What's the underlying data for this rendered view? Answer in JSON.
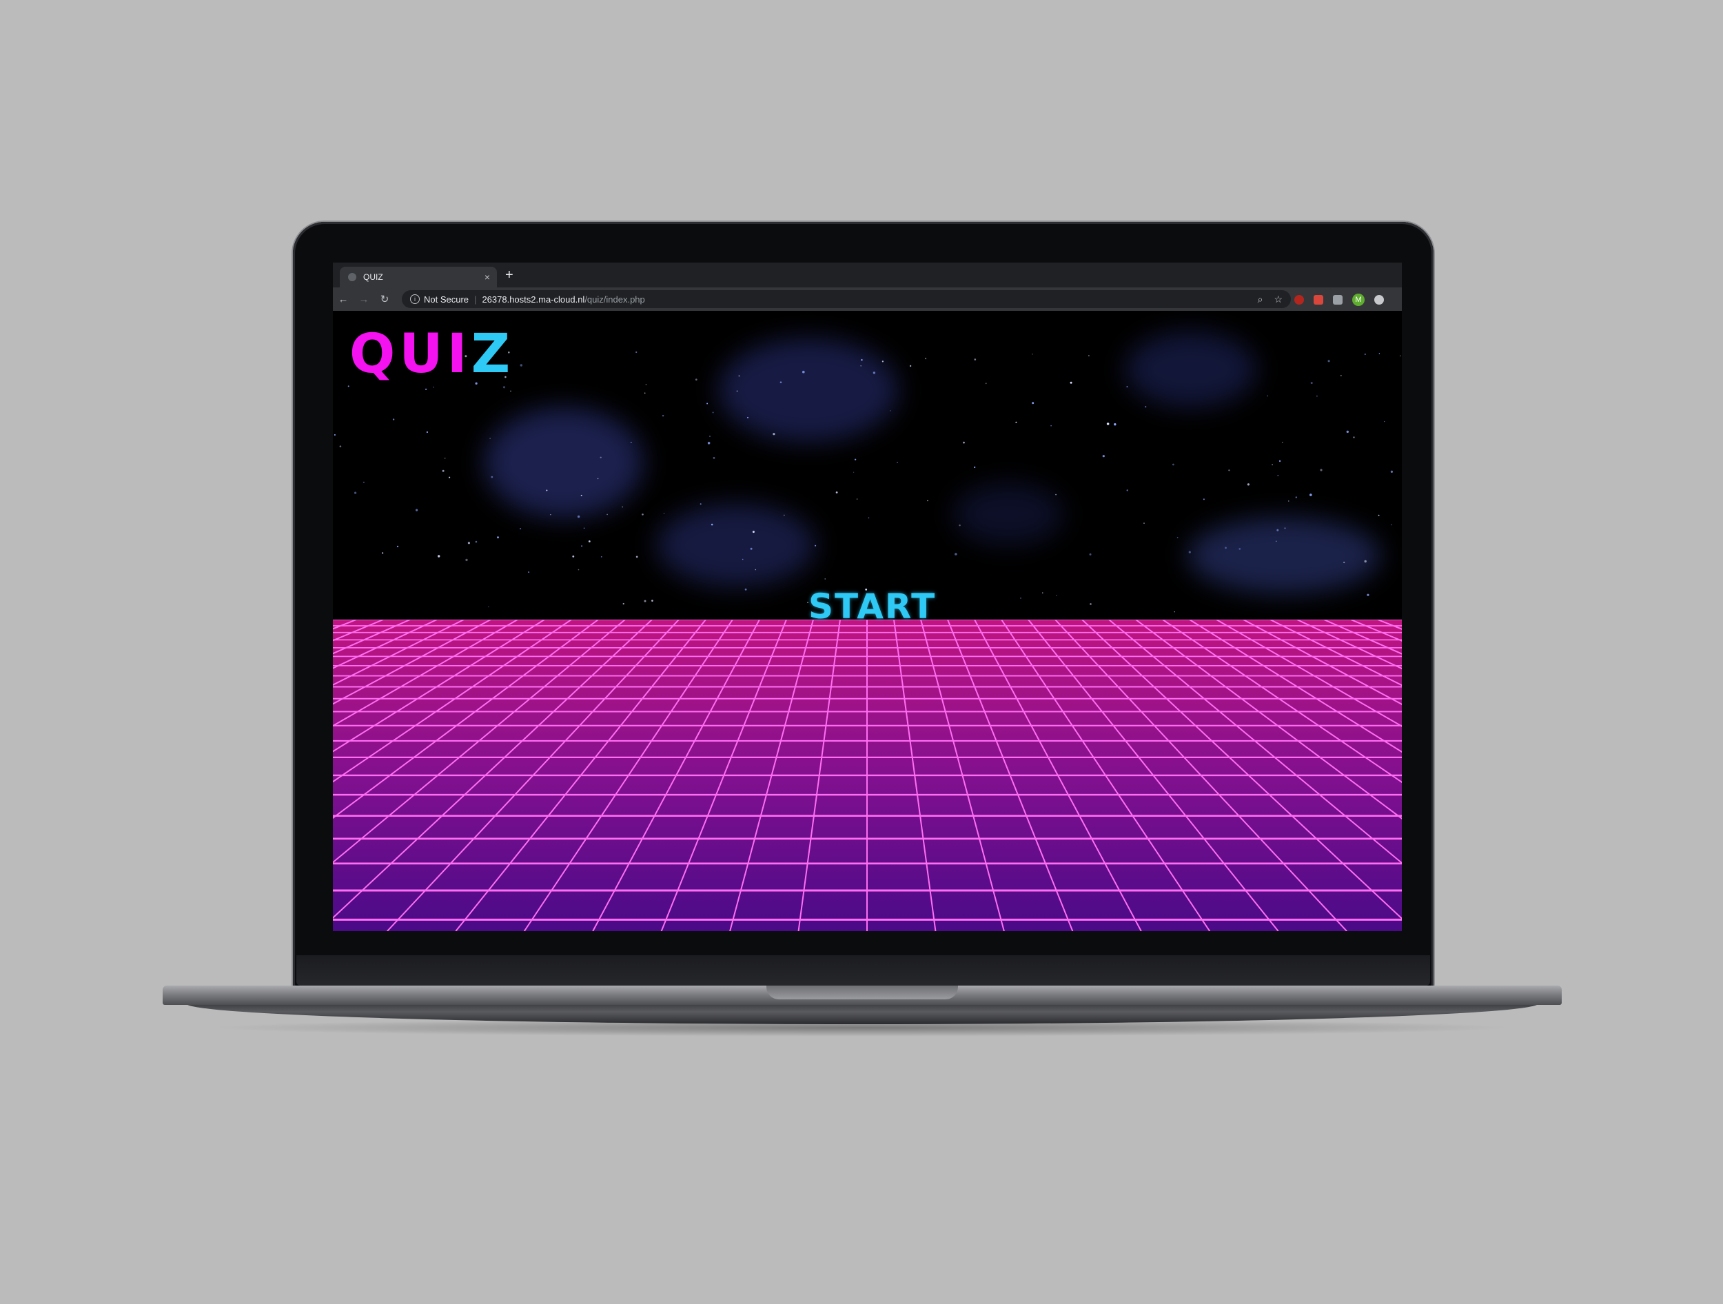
{
  "browser": {
    "tab_title": "QUIZ",
    "new_tab_label": "+",
    "tab_close_label": "×",
    "security_label": "Not Secure",
    "url_host": "26378.hosts2.ma-cloud.nl",
    "url_path": "/quiz/index.php",
    "profile_initial": "M"
  },
  "page": {
    "logo_part1": "QUI",
    "logo_part2": "Z",
    "start_label": "START"
  },
  "colors": {
    "logo_pink": "#f512f0",
    "logo_cyan": "#2ec9f5",
    "grid_line": "#ff6ef2",
    "grid_fill_top": "#c0157f",
    "grid_fill_bottom": "#4a0a88"
  }
}
